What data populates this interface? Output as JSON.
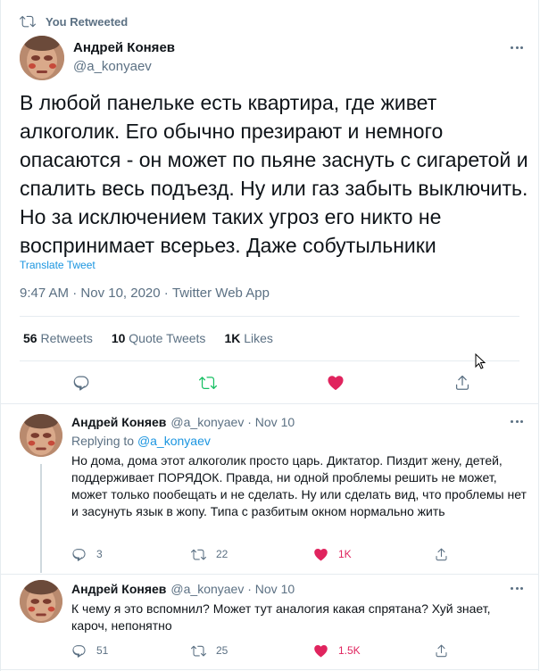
{
  "retweet_banner": {
    "text": "You Retweeted",
    "icon": "retweet-icon"
  },
  "main_tweet": {
    "author_name": "Андрей Коняев",
    "author_handle": "@a_konyaev",
    "text": "В любой панельке есть квартира, где живет алкоголик. Его обычно презирают и немного опасаются - он может по пьяне заснуть с сигаретой и спалить весь подъезд. Ну или газ забыть выключить. Но за исключением таких угроз его никто не воспринимает всерьез. Даже собутыльники",
    "translate_label": "Translate Tweet",
    "time": "9:47 AM",
    "date": "Nov 10, 2020",
    "source": "Twitter Web App",
    "separator": " · ",
    "stats": {
      "retweets_count": "56",
      "retweets_label": "Retweets",
      "quotes_count": "10",
      "quotes_label": "Quote Tweets",
      "likes_count": "1K",
      "likes_label": "Likes"
    }
  },
  "replies": [
    {
      "author_name": "Андрей Коняев",
      "author_handle": "@a_konyaev · Nov 10",
      "replying_prefix": "Replying to",
      "replying_to": "@a_konyaev",
      "text": "Но дома, дома этот алкоголик просто царь. Диктатор. Пиздит жену, детей, поддерживает ПОРЯДОК. Правда, ни одной проблемы решить не может, может только пообещать и не сделать. Ну или сделать вид, что проблемы нет и засунуть язык в жопу. Типа с разбитым окном нормально жить",
      "reply_count": "3",
      "retweet_count": "22",
      "like_count": "1K"
    },
    {
      "author_name": "Андрей Коняев",
      "author_handle": "@a_konyaev · Nov 10",
      "text": "К чему я это вспомнил? Может тут аналогия какая спрятана? Хуй знает, кароч, непонятно",
      "reply_count": "51",
      "retweet_count": "25",
      "like_count": "1.5K"
    }
  ],
  "colors": {
    "accent": "#1b95e0",
    "retweet_green": "#17bf63",
    "like_red": "#e0245e",
    "muted": "#5b7083",
    "divider": "#e6ecf0"
  }
}
